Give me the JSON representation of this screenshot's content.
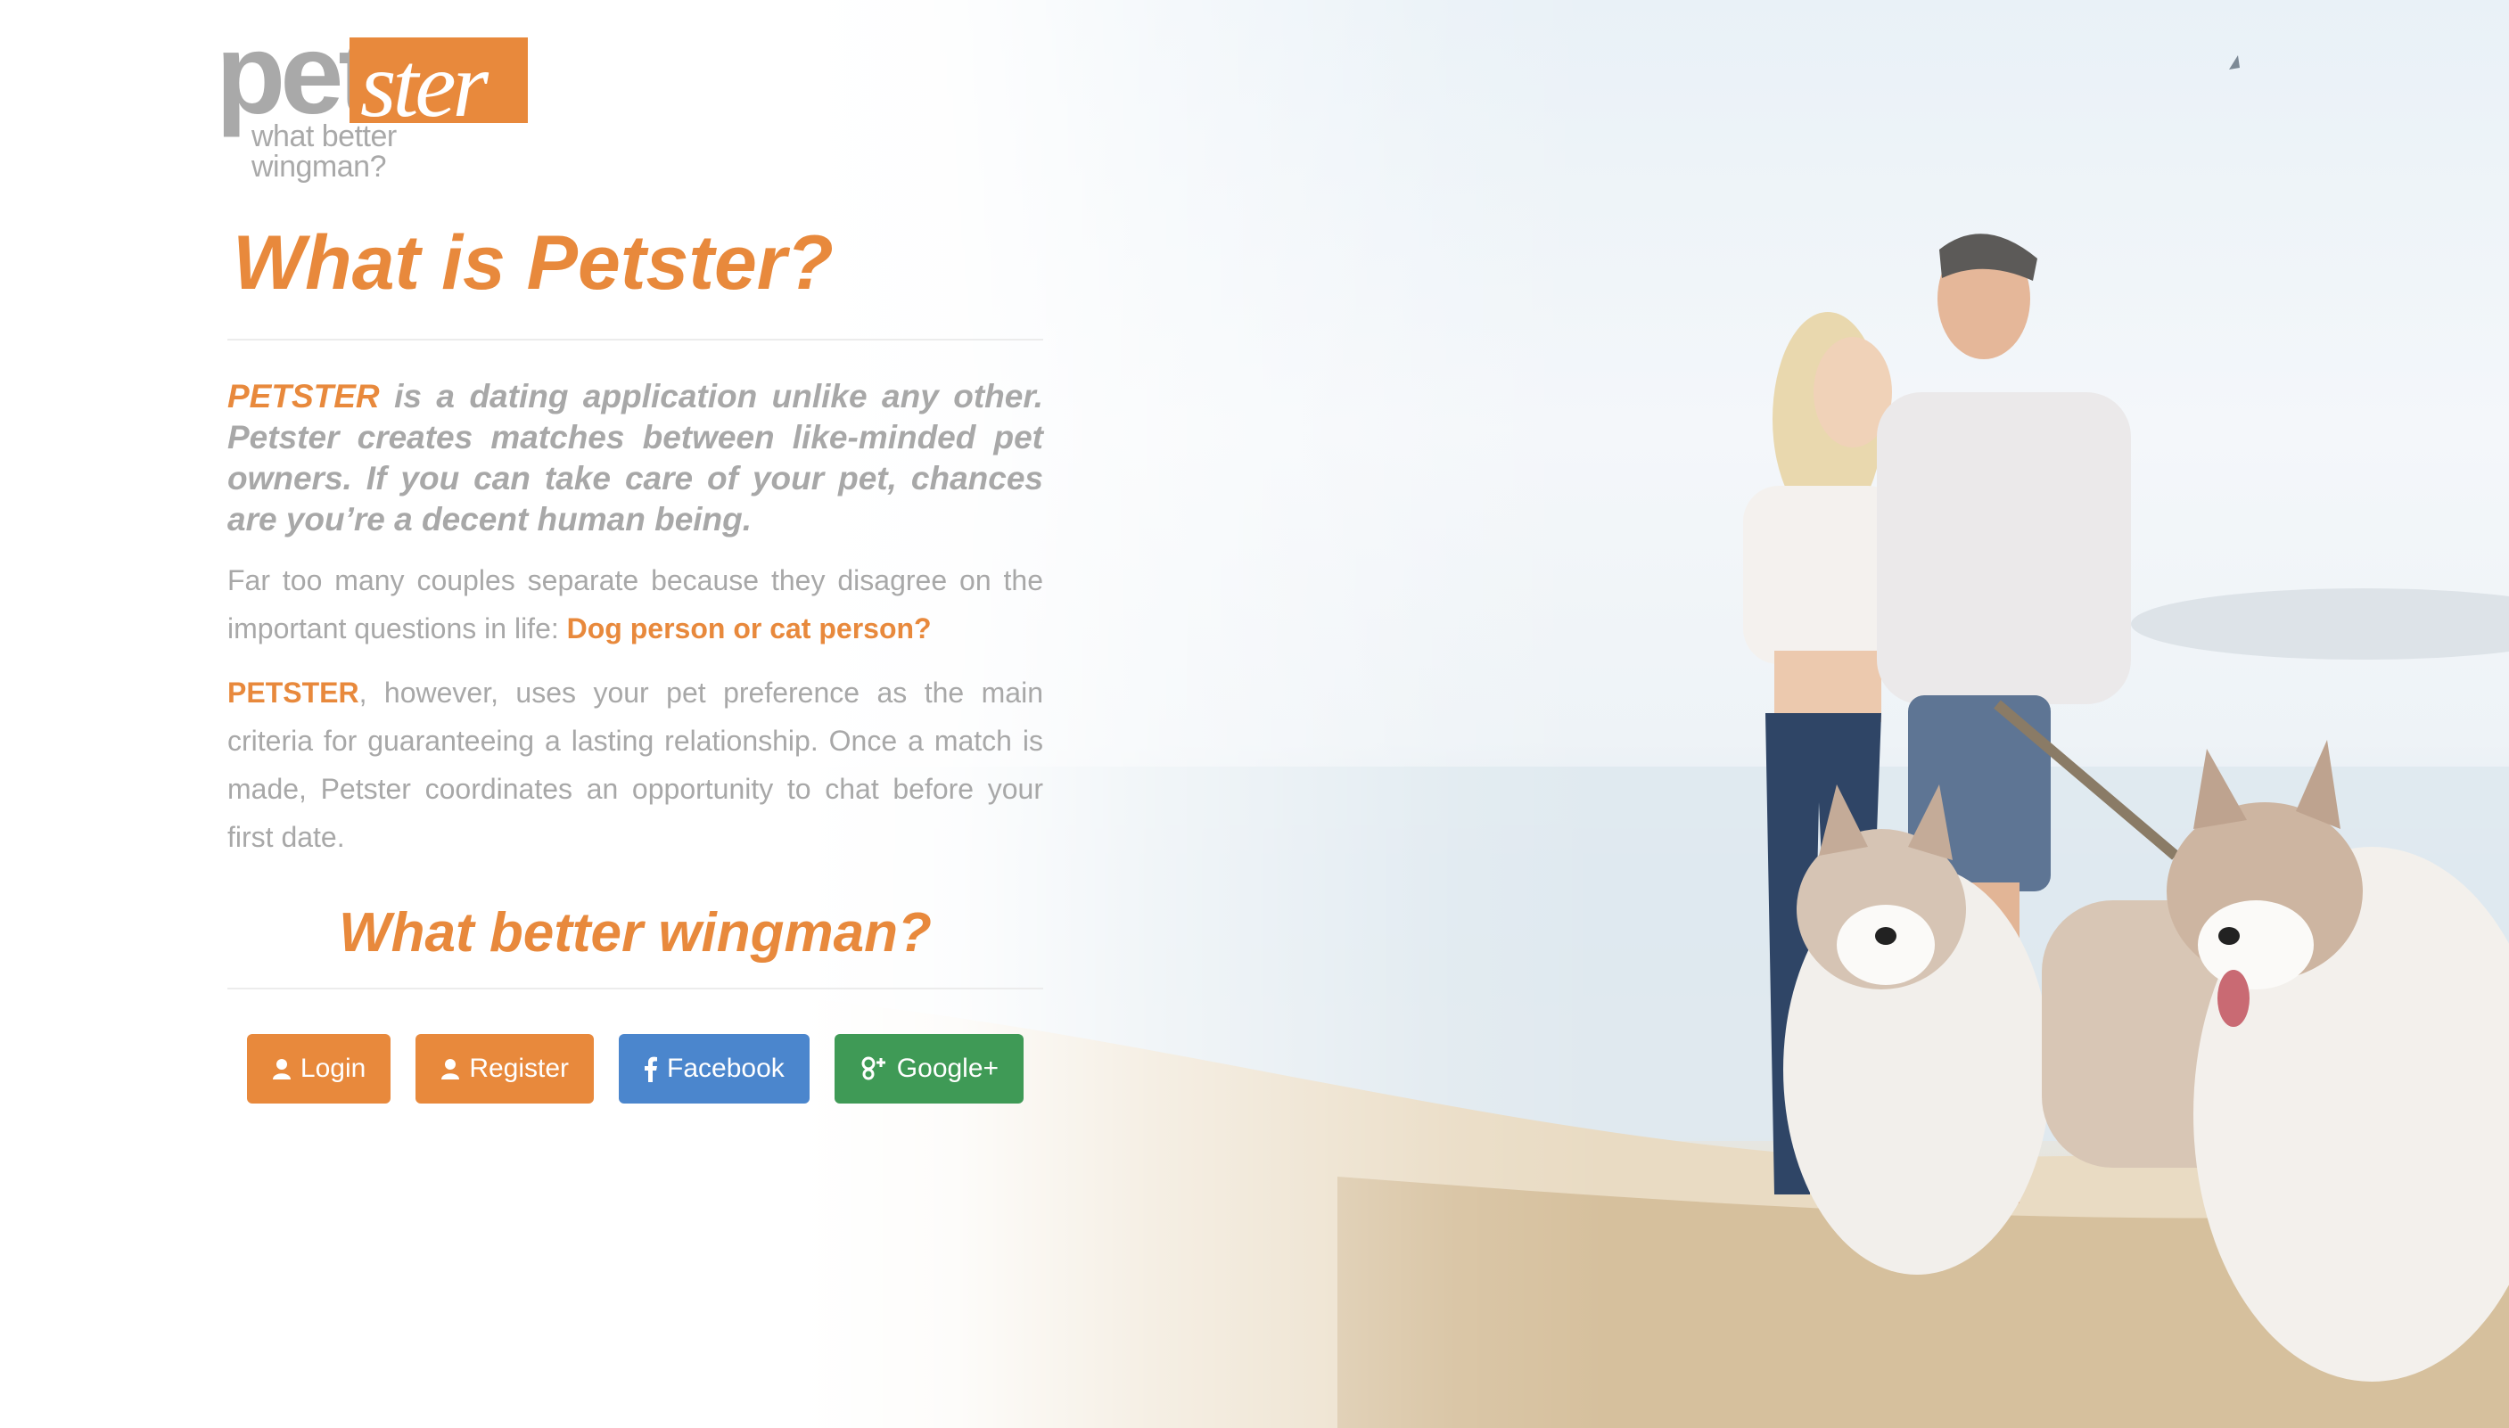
{
  "logo": {
    "word_left": "pet",
    "word_right": "ster",
    "tagline": "what better wingman?"
  },
  "intro": {
    "title": "What is Petster?",
    "lead_brand": "PETSTER",
    "lead_text": " is a dating application unlike any other. Petster creates matches between like-minded pet owners. If you can take care of your pet, chances are you’re a decent human being.",
    "para1_text": "Far too many couples separate because they disagree on the important questions in life: ",
    "para1_highlight": "Dog person or cat person?",
    "para2_brand": "PETSTER",
    "para2_text": ", however, uses your pet preference as the main criteria for guaranteeing a lasting relationship. Once a match is made, Petster coordinates an opportunity to chat before your first date.",
    "subtitle": "What better wingman?"
  },
  "buttons": {
    "login": "Login",
    "register": "Register",
    "facebook": "Facebook",
    "google": "Google+"
  },
  "colors": {
    "accent": "#e8893c",
    "facebook": "#4b86cd",
    "google": "#3f9a56",
    "muted_text": "#a8a8a8"
  },
  "icons": {
    "login": "user-icon",
    "register": "user-icon",
    "facebook": "facebook-icon",
    "google": "google-plus-icon"
  }
}
